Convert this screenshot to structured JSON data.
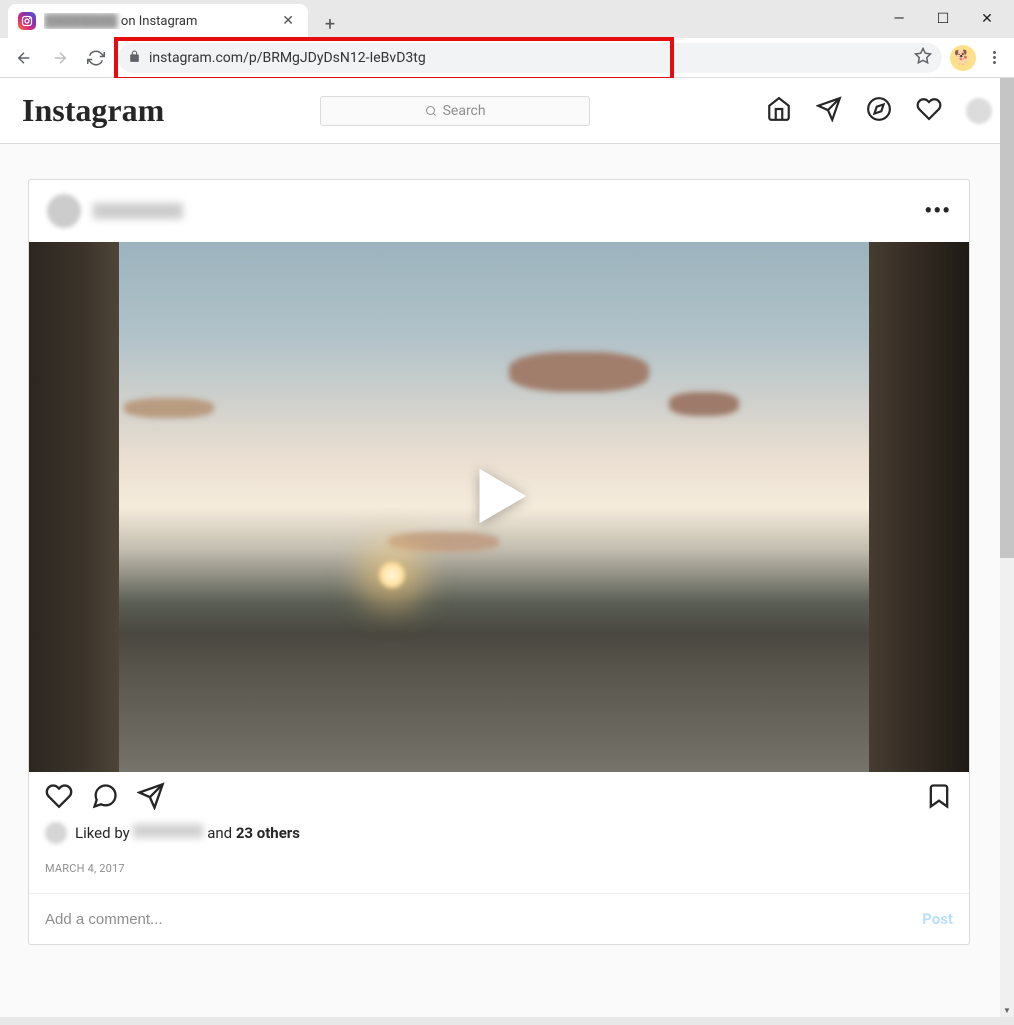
{
  "browser": {
    "tab_title_suffix": " on Instagram",
    "url_visible": "instagram.com/p/BRMgJDyDsN12-IeBvD3tg",
    "url_blur": "                                    "
  },
  "header": {
    "logo_text": "Instagram",
    "search_placeholder": "Search"
  },
  "post": {
    "likes_prefix": "Liked by ",
    "likes_middle": " and ",
    "likes_count_text": "23 others",
    "date": "MARCH 4, 2017",
    "comment_placeholder": "Add a comment...",
    "comment_submit": "Post"
  }
}
